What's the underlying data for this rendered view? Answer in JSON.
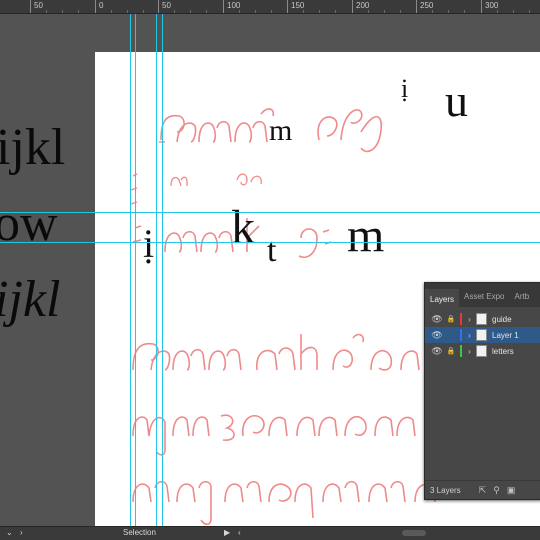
{
  "ruler": {
    "labels": [
      "50",
      "0",
      "50",
      "100",
      "150",
      "200",
      "250",
      "300"
    ]
  },
  "specimens": {
    "line1": "ijkl",
    "line2": "ow",
    "line3": "ijkl"
  },
  "artboard_letters": {
    "m1": "m",
    "u": "u",
    "m2": "m",
    "kt_k": "k",
    "kt_t": "t",
    "mrow": "m"
  },
  "layers_panel": {
    "tabs": [
      "Layers",
      "Asset Expo",
      "Artb"
    ],
    "layers": [
      {
        "name": "guide",
        "color": "#e03c3c",
        "selected": false
      },
      {
        "name": "Layer 1",
        "color": "#3c6ee0",
        "selected": true
      },
      {
        "name": "letters",
        "color": "#3cc83c",
        "selected": false
      }
    ],
    "footer_count": "3 Layers"
  },
  "status": {
    "tool": "Selection"
  },
  "colors": {
    "guide": "#22c7e6",
    "glyph_outline": "#ef8a8a",
    "pasteboard": "#535353",
    "artboard": "#ffffff"
  },
  "icons": [
    "eye-icon",
    "lock-icon",
    "chevron-right-icon",
    "export-icon",
    "search-icon",
    "new-layer-icon"
  ]
}
